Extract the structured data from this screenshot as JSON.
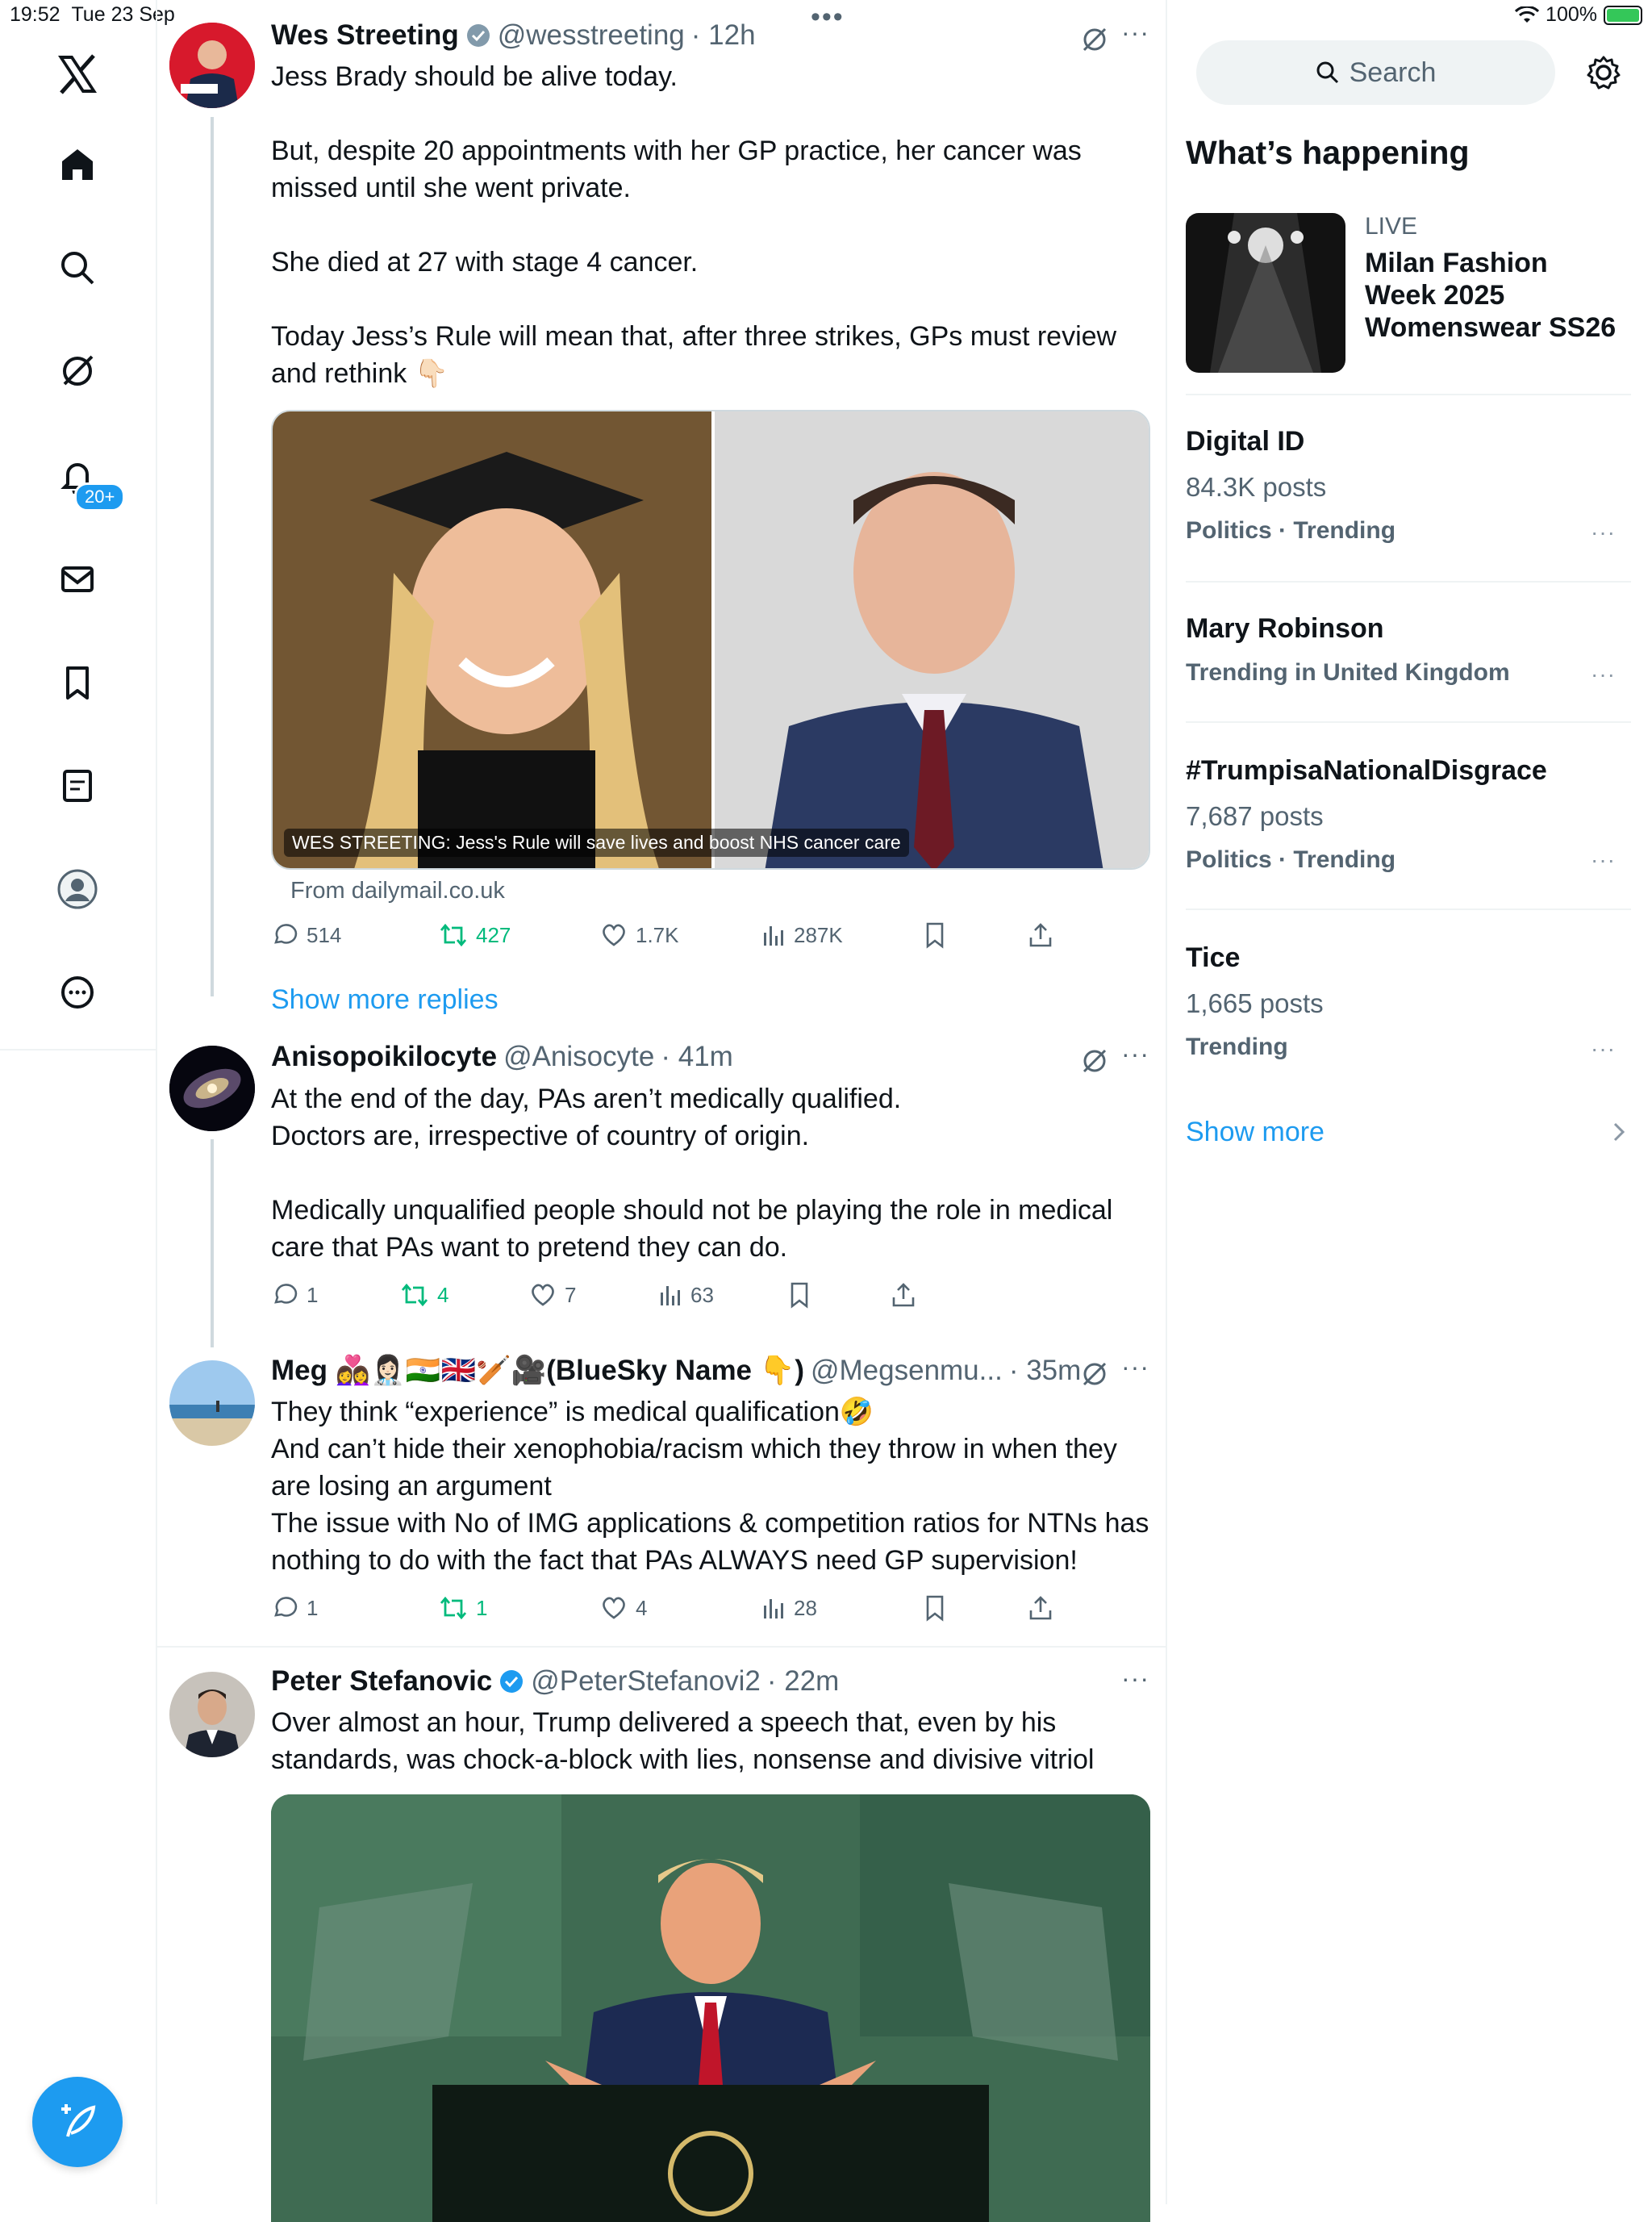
{
  "status": {
    "time": "19:52",
    "date": "Tue 23 Sep",
    "battery": "100%"
  },
  "nav": {
    "badge": "20+"
  },
  "tweets": [
    {
      "name": "Wes Streeting",
      "handle": "@wesstreeting",
      "time": "· 12h",
      "text": "Jess Brady should be alive today.\n\nBut, despite 20 appointments with her GP practice, her cancer was missed until she went private.\n\nShe died at 27 with stage 4 cancer.\n\nToday Jess’s Rule will mean that, after three strikes, GPs must review and rethink 👇🏻",
      "card_caption": "WES STREETING: Jess's Rule will save lives and boost NHS cancer care",
      "card_source": "From dailymail.co.uk",
      "replies": "514",
      "reposts": "427",
      "likes": "1.7K",
      "views": "287K"
    },
    {
      "name": "Anisopoikilocyte",
      "handle": "@Anisocyte",
      "time": "· 41m",
      "text": "At the end of the day, PAs aren’t medically qualified.\nDoctors are, irrespective of country of origin.\n\nMedically unqualified people should not be playing the role in medical care that PAs want to pretend they can do.",
      "replies": "1",
      "reposts": "4",
      "likes": "7",
      "views": "63"
    },
    {
      "name": "Meg 👩‍❤️‍👩👩🏻‍⚕️🇮🇳🇬🇧🏏🎥(BlueSky Name 👇)",
      "handle": "@Megsenmu...",
      "time": "· 35m",
      "text": "They think “experience” is medical qualification🤣\nAnd can’t hide their xenophobia/racism which they throw in when they are losing an argument\nThe issue with No of IMG applications & competition ratios for NTNs has nothing to do with the fact that PAs ALWAYS need GP supervision!",
      "replies": "1",
      "reposts": "1",
      "likes": "4",
      "views": "28"
    },
    {
      "name": "Peter Stefanovic",
      "handle": "@PeterStefanovi2",
      "time": "· 22m",
      "text": "Over almost an hour, Trump delivered a speech that, even by his standards, was chock-a-block with lies, nonsense and divisive vitriol"
    }
  ],
  "show_more_replies": "Show more replies",
  "sidebar": {
    "search_placeholder": "Search",
    "heading": "What’s happening",
    "live": {
      "label": "LIVE",
      "title": "Milan Fashion Week 2025 Womenswear SS26"
    },
    "trends": [
      {
        "title": "Digital ID",
        "count": "84.3K posts",
        "category": "Politics · Trending"
      },
      {
        "title": "Mary Robinson",
        "count": "",
        "category": "Trending in United Kingdom"
      },
      {
        "title": "#TrumpisaNationalDisgrace",
        "count": "7,687 posts",
        "category": "Politics · Trending"
      },
      {
        "title": "Tice",
        "count": "1,665 posts",
        "category": "Trending"
      }
    ],
    "show_more": "Show more"
  },
  "colors": {
    "accent": "#1d9bf0",
    "repost_green": "#00ba7c",
    "secondary": "#536471",
    "border": "#eff3f4"
  }
}
